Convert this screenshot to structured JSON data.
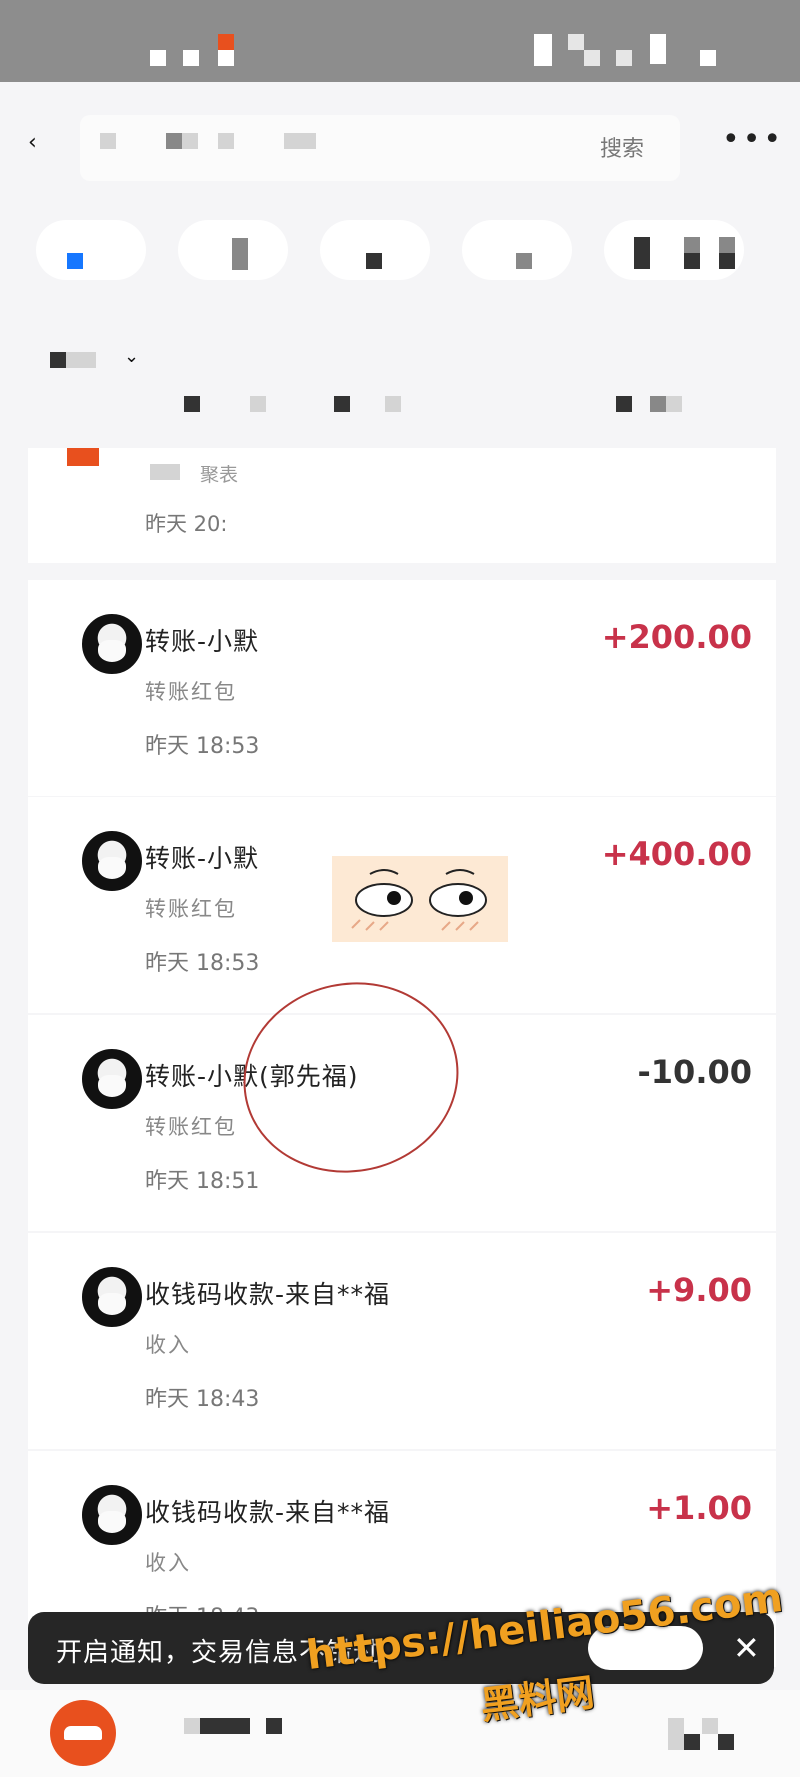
{
  "header": {
    "search_label": "搜索",
    "back_icon": "chevron-left-icon",
    "more_icon": "more-horizontal-icon"
  },
  "partial_top": {
    "type": "聚表",
    "time": "昨天 20:"
  },
  "transactions": [
    {
      "title": "转账-小默",
      "type": "转账红包",
      "time": "昨天 18:53",
      "amount": "+200.00"
    },
    {
      "title": "转账-小默",
      "type": "转账红包",
      "time": "昨天 18:53",
      "amount": "+400.00"
    },
    {
      "title": "转账-小默(郭先福)",
      "type": "转账红包",
      "time": "昨天 18:51",
      "amount": "-10.00"
    },
    {
      "title": "收钱码收款-来自**福",
      "type": "收入",
      "time": "昨天 18:43",
      "amount": "+9.00"
    },
    {
      "title": "收钱码收款-来自**福",
      "type": "收入",
      "time": "昨天 18:43",
      "amount": "+1.00"
    }
  ],
  "toast": {
    "text": "开启通知，交易信息不错过",
    "close_icon": "close-icon"
  },
  "watermark": {
    "url": "https://heiliao56.com",
    "name": "黑料网"
  },
  "colors": {
    "income": "#c8324a",
    "expense": "#333333",
    "accent": "#e8501e"
  }
}
